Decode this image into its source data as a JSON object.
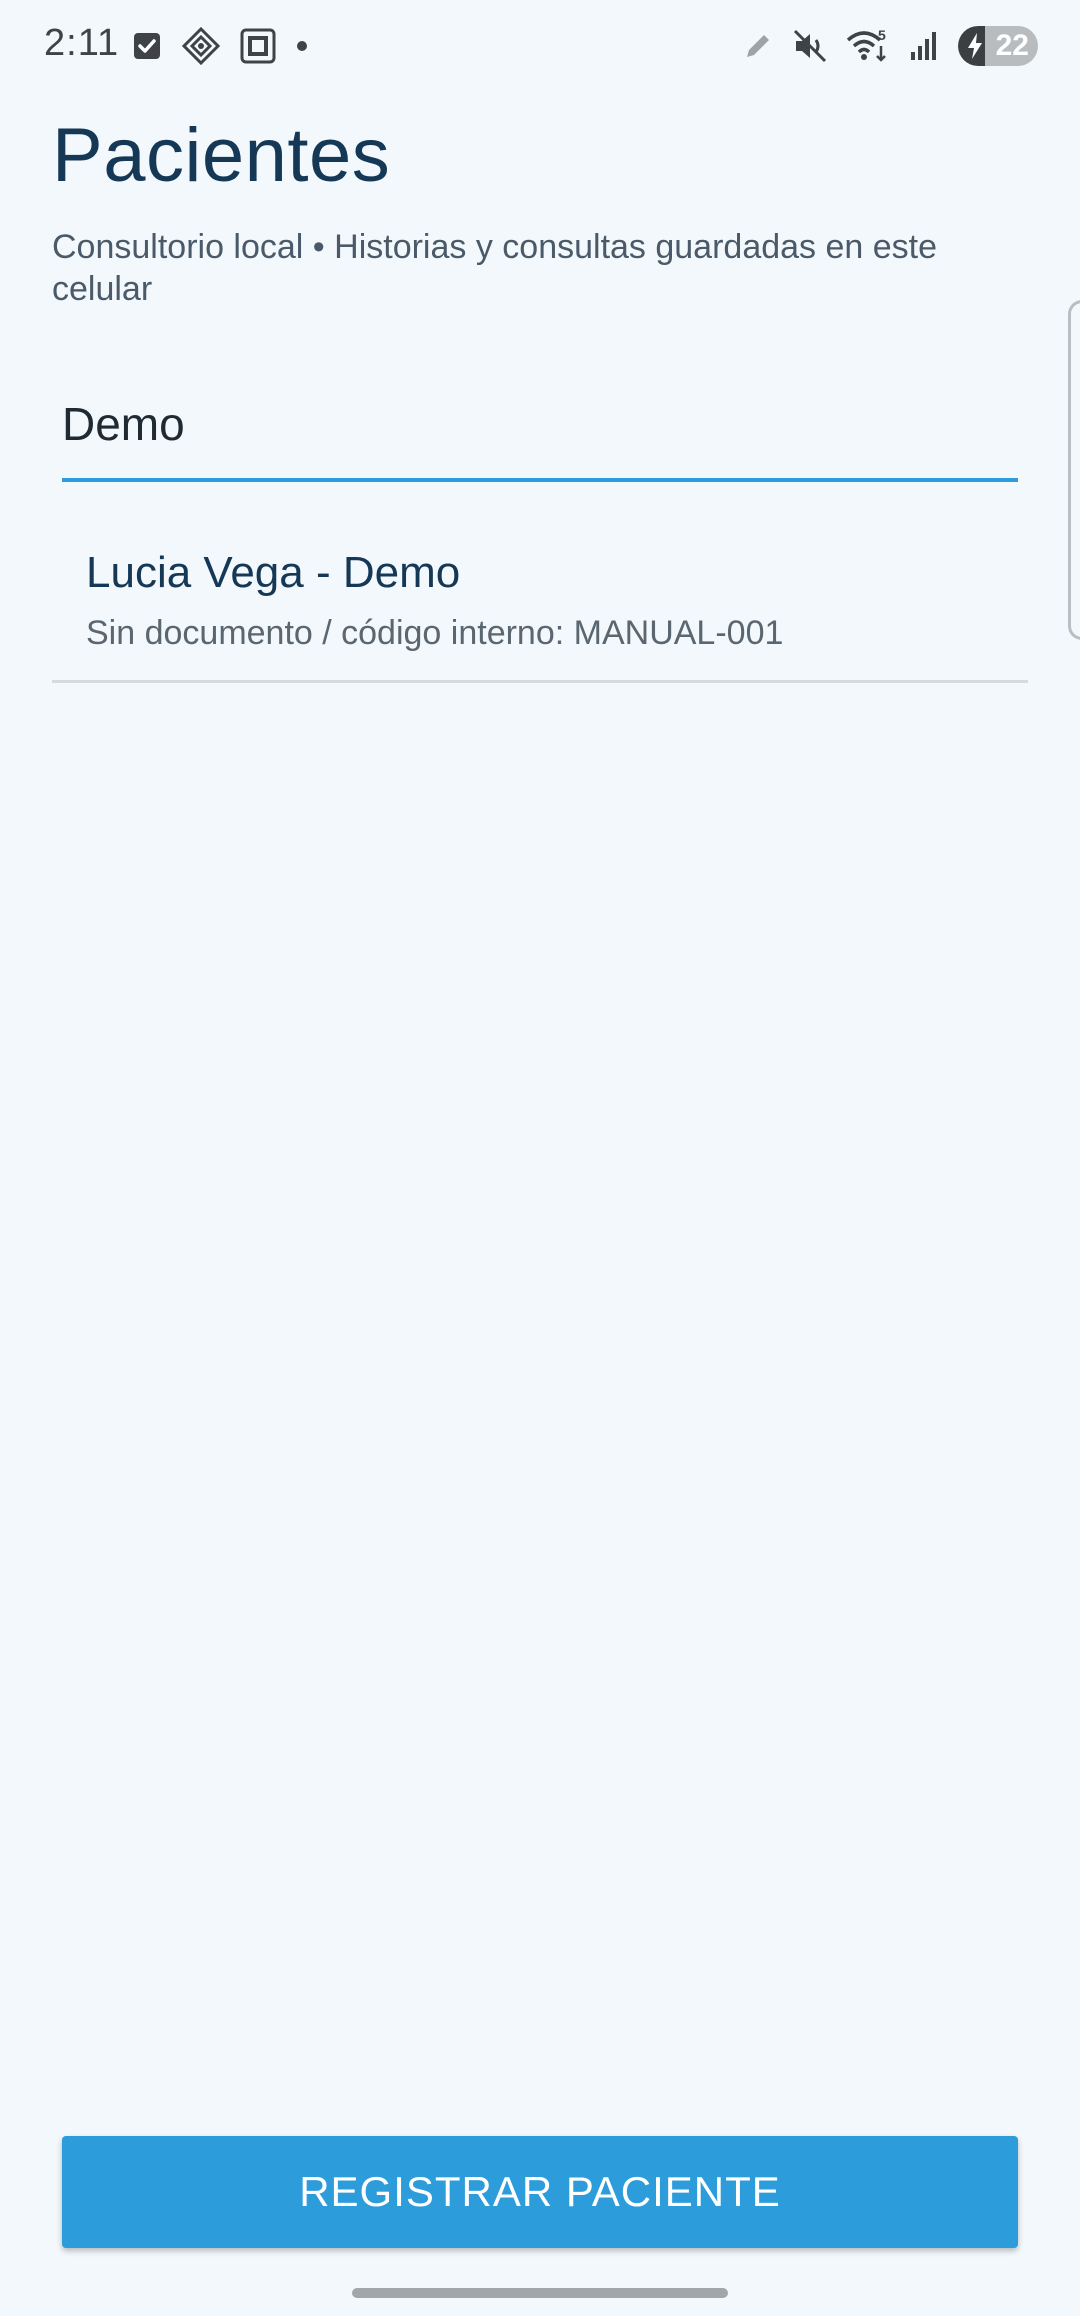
{
  "status_bar": {
    "time": "2:11",
    "battery_level": "22",
    "battery_fraction": 0.22,
    "wifi_badge": "5",
    "left_icons": [
      "checkbox-icon",
      "diamond-app-icon",
      "square-app-icon",
      "dot-icon"
    ],
    "right_icons": [
      "pen-icon",
      "mute-icon",
      "wifi-icon",
      "signal-icon",
      "battery-icon"
    ]
  },
  "header": {
    "title": "Pacientes",
    "subtitle": "Consultorio local • Historias y consultas guardadas en este celular"
  },
  "search": {
    "value": "Demo"
  },
  "patients": [
    {
      "name": "Lucia Vega - Demo",
      "detail": "Sin documento / código interno: MANUAL-001"
    }
  ],
  "actions": {
    "register_label": "REGISTRAR PACIENTE"
  },
  "colors": {
    "background": "#f3f8fc",
    "accent": "#2d9cdb",
    "title": "#153856",
    "divider": "#d6dadd"
  }
}
